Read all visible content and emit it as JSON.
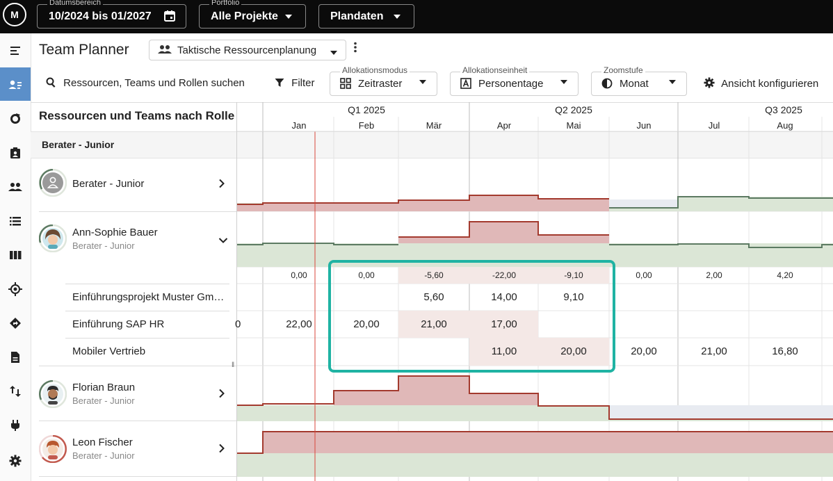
{
  "topbar": {
    "logo_text": "M",
    "date_range": {
      "label": "Datumsbereich",
      "value": "10/2024 bis 01/2027"
    },
    "portfolio": {
      "label": "Portfolio",
      "value": "Alle Projekte"
    },
    "plandata": {
      "value": "Plandaten"
    }
  },
  "sidebar": {
    "items": [
      {
        "icon": "menu-collapse-icon"
      },
      {
        "icon": "team-planner-icon",
        "active": true
      },
      {
        "icon": "refresh-icon"
      },
      {
        "icon": "clipboard-person-icon"
      },
      {
        "icon": "people-icon"
      },
      {
        "icon": "list-icon"
      },
      {
        "icon": "columns-icon"
      },
      {
        "icon": "target-icon"
      },
      {
        "icon": "diamond-arrow-icon"
      },
      {
        "icon": "document-icon"
      },
      {
        "icon": "swap-vert-icon"
      },
      {
        "icon": "plug-icon"
      },
      {
        "icon": "gear-icon"
      }
    ]
  },
  "header": {
    "title": "Team Planner",
    "view_select": "Taktische Ressourcenplanung"
  },
  "toolbar": {
    "search_label": "Ressourcen, Teams und Rollen suchen",
    "filter_label": "Filter",
    "allocation_mode": {
      "label": "Allokationsmodus",
      "value": "Zeitraster"
    },
    "allocation_unit": {
      "label": "Allokationseinheit",
      "value": "Personentage"
    },
    "zoom": {
      "label": "Zoomstufe",
      "value": "Monat"
    },
    "configure_label": "Ansicht konfigurieren"
  },
  "grid": {
    "section_title": "Ressourcen und Teams nach Rolle",
    "group_label": "Berater - Junior",
    "quarters": [
      "Q1 2025",
      "Q2 2025",
      "Q3 2025"
    ],
    "months": [
      "Jan",
      "Feb",
      "Mär",
      "Apr",
      "Mai",
      "Jun",
      "Jul",
      "Aug"
    ],
    "resources": [
      {
        "name": "Berater - Junior",
        "role": ""
      },
      {
        "name": "Ann-Sophie Bauer",
        "role": "Berater - Junior"
      },
      {
        "name": "Florian Braun",
        "role": "Berater - Junior"
      },
      {
        "name": "Leon Fischer",
        "role": "Berater - Junior"
      }
    ],
    "capacity_row": [
      "0,00",
      "0,00",
      "-5,60",
      "-22,00",
      "-9,10",
      "0,00",
      "2,00",
      "4,20"
    ],
    "projects": [
      {
        "name": "Einführungsprojekt Muster Gm…",
        "values": [
          "",
          "",
          "5,60",
          "14,00",
          "9,10",
          "",
          "",
          ""
        ]
      },
      {
        "name": "Einführung SAP HR",
        "leading": "0",
        "values": [
          "22,00",
          "20,00",
          "21,00",
          "17,00",
          "",
          "",
          "",
          ""
        ]
      },
      {
        "name": "Mobiler Vertrieb",
        "values": [
          "",
          "",
          "",
          "11,00",
          "20,00",
          "20,00",
          "21,00",
          "16,80"
        ]
      }
    ]
  },
  "colors": {
    "over_allocation": "#e0b8b8",
    "over_line": "#a33a2e",
    "under_allocation": "#dbe6d6",
    "under_line": "#5c7a62",
    "highlight_box": "#1fb3a3",
    "today_line": "#d9463a",
    "sidebar_active": "#5b8fc9"
  }
}
